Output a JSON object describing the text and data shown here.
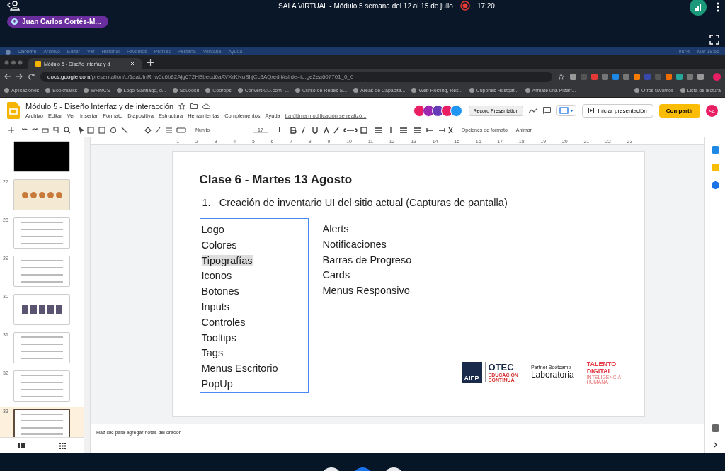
{
  "meeting": {
    "title": "SALA VIRTUAL - Módulo 5 semana del 12 al 15 de julio",
    "time": "17:20",
    "participant": "Juan Carlos Cortés-M..."
  },
  "mac_menu": {
    "items": [
      "Chrome",
      "Archivo",
      "Editar",
      "Ver",
      "Historial",
      "Favoritos",
      "Perfiles",
      "Pestaña",
      "Ventana",
      "Ayuda"
    ],
    "battery": "98 %",
    "clock": "Mar 18:55"
  },
  "browser": {
    "tabs": [
      {
        "title": "Módulo 5 - Diseño Interfaz y d",
        "selected": true
      }
    ],
    "url_domain": "docs.google.com",
    "url_path": "/presentation/d/1aaUlnRnw5c6b82Ajg672HBbecd6aAVXrKNuShjCc3AQ/edit#slide=id.ge2ea607701_0_0",
    "bookmarks": [
      "Aplicaciones",
      "Bookmarks",
      "WHMCS",
      "Logo 'Santiago, d...",
      "Squoosh",
      "Codrops",
      "ConvertICO.com -...",
      "Curso de Redes S...",
      "Áreas de Capacita...",
      "Web Hosting, Res...",
      "Cupones Hostgat...",
      "Armate una Pizarr..."
    ],
    "other_bookmarks": "Otros favoritos",
    "reading_list": "Lista de lectura"
  },
  "slides_app": {
    "doc_title": "Módulo 5 - Diseño Interfaz y de interacción",
    "menu": [
      "Archivo",
      "Editar",
      "Ver",
      "Insertar",
      "Formato",
      "Diapositiva",
      "Estructura",
      "Herramientas",
      "Complementos",
      "Ayuda"
    ],
    "last_edit": "La última modificación se realizó...",
    "record": "Record Presentation",
    "present": "Iniciar presentación",
    "share": "Compartir",
    "avatar": "<a",
    "font": "Nunito",
    "font_size": "17",
    "format_options": "Opciones de formato",
    "animate": "Animar",
    "ruler": [
      "1",
      "2",
      "3",
      "4",
      "5",
      "6",
      "7",
      "8",
      "9",
      "10",
      "11",
      "12",
      "13",
      "14",
      "15",
      "16",
      "17",
      "18",
      "19",
      "20",
      "21",
      "22",
      "23"
    ]
  },
  "thumbnails": [
    {
      "kind": "dark",
      "selected": false
    },
    {
      "number": "27",
      "kind": "icons",
      "selected": false
    },
    {
      "number": "28",
      "kind": "list",
      "selected": false
    },
    {
      "number": "29",
      "kind": "list",
      "selected": false
    },
    {
      "number": "30",
      "kind": "flow",
      "selected": false
    },
    {
      "number": "31",
      "kind": "text",
      "selected": false
    },
    {
      "number": "32",
      "kind": "text",
      "selected": false
    },
    {
      "number": "33",
      "kind": "text",
      "selected": true
    }
  ],
  "slide": {
    "title": "Clase 6 - Martes 13 Agosto",
    "numbered": [
      {
        "number": "1.",
        "text": "Creación de inventario UI del sitio actual (Capturas de pantalla)"
      }
    ],
    "column_1": {
      "selected": true,
      "items": [
        {
          "text": "Logo",
          "selected": false
        },
        {
          "text": "Colores",
          "selected": false
        },
        {
          "text": "Tipografías",
          "selected": true
        },
        {
          "text": "Iconos",
          "selected": false
        },
        {
          "text": "Botones",
          "selected": false
        },
        {
          "text": "Inputs",
          "selected": false
        },
        {
          "text": "Controles",
          "selected": false
        },
        {
          "text": "Tooltips",
          "selected": false
        },
        {
          "text": "Tags",
          "selected": false
        },
        {
          "text": "Menus Escritorio",
          "selected": false
        },
        {
          "text": "PopUp",
          "selected": false
        }
      ]
    },
    "column_2": {
      "items": [
        {
          "text": "Alerts"
        },
        {
          "text": "Notificaciones"
        },
        {
          "text": "Barras de Progreso"
        },
        {
          "text": "Cards"
        },
        {
          "text": "Menus Responsivo"
        }
      ]
    },
    "logos": {
      "aiep": "AIEP",
      "otec": "OTEC",
      "otec_sub": [
        "EDUCACIÓN",
        "CONTINUA"
      ],
      "partner": "Partner Bootcamp",
      "laboratoria": "Laboratoria",
      "talento": [
        "TALENTO",
        "DIGITAL"
      ],
      "talento_sub": "INTELIGENCIA HUMANA"
    }
  },
  "notes": {
    "placeholder": "Haz clic para agregar notas del orador"
  }
}
